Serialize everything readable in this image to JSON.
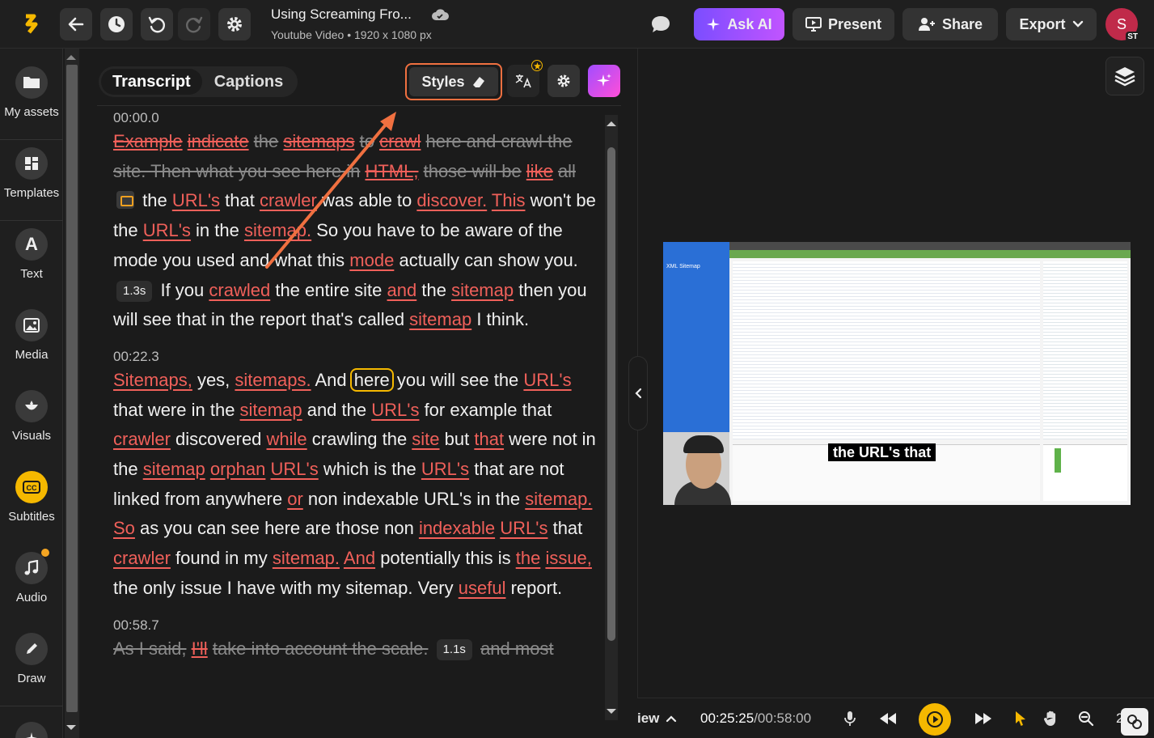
{
  "topbar": {
    "project_title": "Using Screaming Fro...",
    "project_subtitle": "Youtube Video • 1920 x 1080 px",
    "ask_ai_label": "Ask AI",
    "present_label": "Present",
    "share_label": "Share",
    "export_label": "Export",
    "avatar_initial": "S",
    "avatar_badge": "ST"
  },
  "sidebar": {
    "items": [
      {
        "label": "My assets",
        "icon": "folder-icon"
      },
      {
        "label": "Templates",
        "icon": "templates-icon"
      },
      {
        "label": "Text",
        "icon": "text-icon"
      },
      {
        "label": "Media",
        "icon": "image-icon"
      },
      {
        "label": "Visuals",
        "icon": "visuals-icon"
      },
      {
        "label": "Subtitles",
        "icon": "cc-icon"
      },
      {
        "label": "Audio",
        "icon": "music-icon"
      },
      {
        "label": "Draw",
        "icon": "pen-icon"
      }
    ]
  },
  "panel": {
    "tabs": [
      "Transcript",
      "Captions"
    ],
    "active_tab": "Transcript",
    "styles_label": "Styles",
    "text_icon_glyph": "A",
    "paragraphs": [
      {
        "timestamp": "00:00.0"
      },
      {
        "timestamp": "00:22.3"
      },
      {
        "timestamp": "00:58.7"
      }
    ],
    "pause_1": "1.3s",
    "pause_2": "1.1s"
  },
  "preview": {
    "caption_text": "the URL's that",
    "video_sidebar_title": "XML Sitemap"
  },
  "controls": {
    "view_label": "iew",
    "time_current": "00:25:25",
    "time_total": "/00:58:00",
    "zoom_partial": "2"
  },
  "colors": {
    "accent": "#f5b800",
    "highlight_red": "#f0605a",
    "styles_border": "#f07040",
    "ai_gradient_start": "#7b4dff",
    "ai_gradient_end": "#c154ff"
  }
}
